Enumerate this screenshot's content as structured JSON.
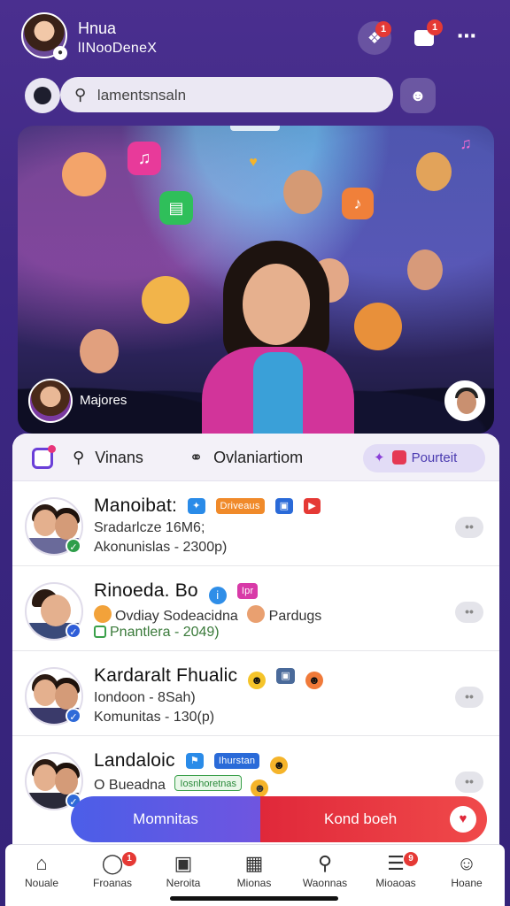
{
  "header": {
    "user_name": "Hnua",
    "user_subtitle": "lINooDeneX",
    "notification_badge": "1",
    "message_badge": "1"
  },
  "search": {
    "placeholder": "lamentsnsaln"
  },
  "hero": {
    "featured_label": "Majores"
  },
  "tabs": {
    "tab1": "Vinans",
    "tab2": "Ovlaniartiom",
    "pill": "Pourteit"
  },
  "list": [
    {
      "title": "Manoibat:",
      "line1": "Sradarlcze 16M6;",
      "line2": "Akonunislas - 2300p)",
      "chip1": "Driveaus"
    },
    {
      "title": "Rinoeda. Bo",
      "line1": "Ovdiay Sodeacidna",
      "line1b": "Pardugs",
      "line2": "Pnantlera - 2049)",
      "chip1": "Ipr"
    },
    {
      "title": "Kardaralt Fhualic",
      "line1": "Iondoon - 8Sah)",
      "line2": "Komunitas - 130(p)"
    },
    {
      "title": "Landaloic",
      "line1": "O Bueadna",
      "chip1": "Ihurstan",
      "chip2": "Iosnhoretnas"
    }
  ],
  "cta": {
    "left_label": "Momnitas",
    "right_label": "Kond boeh"
  },
  "nav": [
    {
      "label": "Nouale",
      "icon": "home-icon"
    },
    {
      "label": "Froanas",
      "icon": "shield-icon",
      "badge": "1"
    },
    {
      "label": "Neroita",
      "icon": "sticker-icon"
    },
    {
      "label": "Mionas",
      "icon": "grid-icon"
    },
    {
      "label": "Waonnas",
      "icon": "search-icon"
    },
    {
      "label": "Mioaoas",
      "icon": "clipboard-icon",
      "badge": "9"
    },
    {
      "label": "Hoane",
      "icon": "person-icon"
    }
  ],
  "colors": {
    "background": "#3b2680",
    "accent": "#6a3fd8",
    "cta_left": "#4b5ee8",
    "cta_right": "#e0283a",
    "badge": "#e53935"
  }
}
